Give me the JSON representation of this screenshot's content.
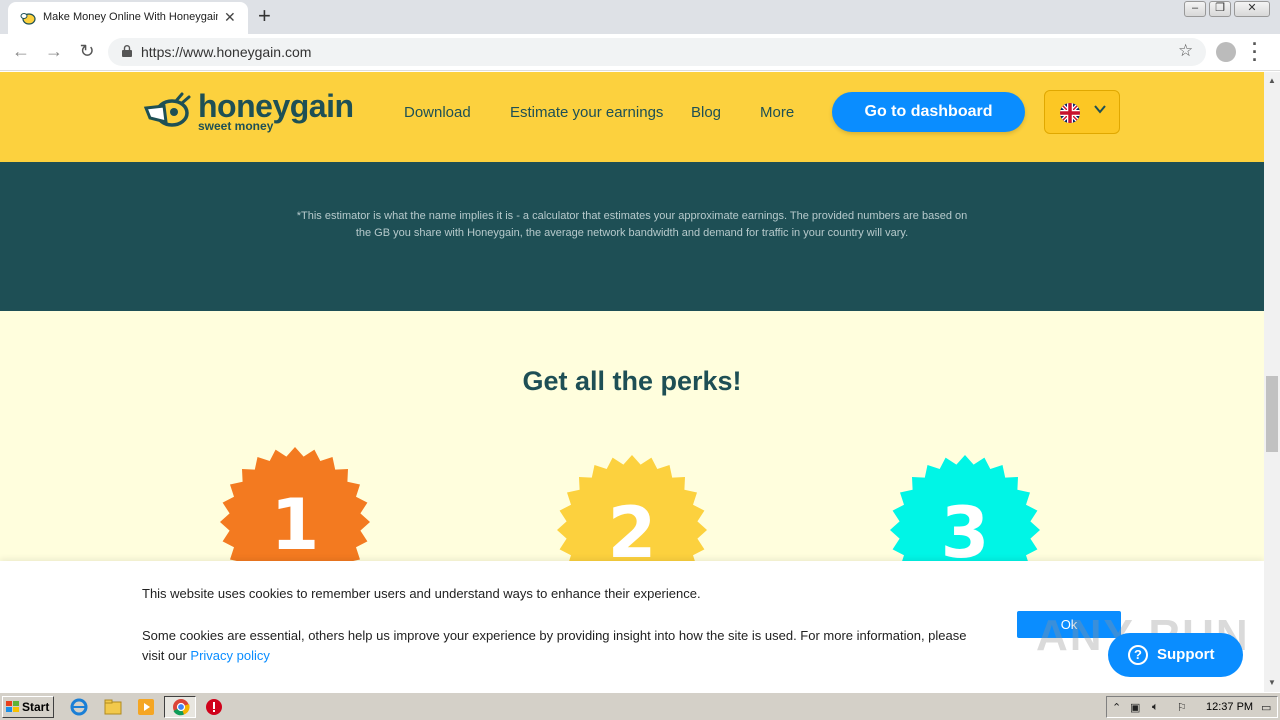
{
  "browser": {
    "tab_title": "Make Money Online With Honeygain",
    "tab_close": "✕",
    "new_tab": "+",
    "url": "https://www.honeygain.com",
    "window_controls": [
      "minimize",
      "restore",
      "close"
    ]
  },
  "site": {
    "logo_text": "honeygain",
    "logo_sub": "sweet money",
    "nav": [
      "Download",
      "Estimate your earnings",
      "Blog",
      "More"
    ],
    "cta": "Go to dashboard",
    "language_flag": "uk-flag-icon",
    "brand_colors": {
      "yellow": "#fcd13e",
      "teal": "#1e4f55",
      "blue": "#0a8dff",
      "cream": "#fffedd"
    }
  },
  "estimator": {
    "disclaimer": "*This estimator is what the name implies it is - a calculator that estimates your approximate earnings. The provided numbers are based on the GB you share with Honeygain, the average network bandwidth and demand for traffic in your country will vary."
  },
  "perks": {
    "title": "Get all the perks!",
    "badges": [
      {
        "number": "1",
        "color": "#f37a20"
      },
      {
        "number": "2",
        "color": "#fcd13e"
      },
      {
        "number": "3",
        "color": "#00f5e6"
      }
    ]
  },
  "cookie": {
    "line1": "This website uses cookies to remember users and understand ways to enhance their experience.",
    "line2_prefix": "Some cookies are essential, others help us improve your experience by providing insight into how the site is used. For more information, please visit our ",
    "privacy_link": "Privacy policy",
    "ok": "Ok",
    "support": "Support",
    "support_icon": "?"
  },
  "watermark": "ANY RUN",
  "taskbar": {
    "start": "Start",
    "clock": "12:37 PM"
  }
}
